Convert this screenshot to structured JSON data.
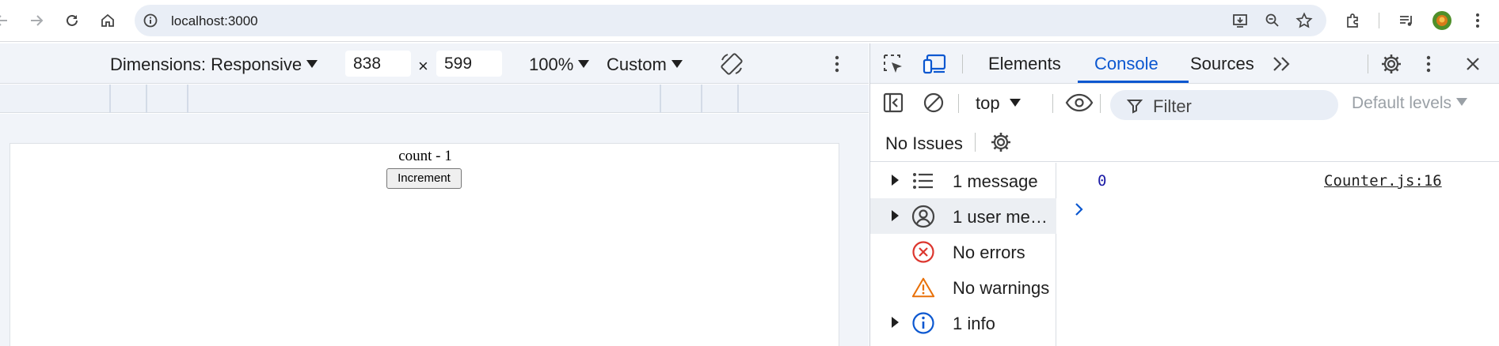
{
  "browser": {
    "url": "localhost:3000",
    "icons": [
      "back-icon",
      "forward-icon",
      "reload-icon",
      "home-icon",
      "site-info-icon",
      "install-app-icon",
      "zoom-icon",
      "bookmark-star-icon",
      "extensions-icon",
      "media-control-icon",
      "profile-avatar",
      "more-vert-icon"
    ]
  },
  "device_toolbar": {
    "dimensions_label": "Dimensions: Responsive",
    "width": "838",
    "times": "×",
    "height": "599",
    "zoom": "100%",
    "throttle": "Custom"
  },
  "page": {
    "counter_text": "count - 1",
    "increment_label": "Increment"
  },
  "devtools": {
    "tabs": [
      "Elements",
      "Console",
      "Sources"
    ],
    "active_tab": "Console",
    "more_tabs": "»",
    "context": "top",
    "filter_placeholder": "Filter",
    "levels": "Default levels",
    "issues": "No Issues",
    "sidebar": [
      {
        "label": "1 message",
        "icon": "list-icon",
        "expandable": true
      },
      {
        "label": "1 user mes…",
        "icon": "user-icon",
        "expandable": true
      },
      {
        "label": "No errors",
        "icon": "error-icon",
        "expandable": false
      },
      {
        "label": "No warnings",
        "icon": "warning-icon",
        "expandable": false
      },
      {
        "label": "1 info",
        "icon": "info-icon",
        "expandable": true
      }
    ],
    "log_value": "0",
    "log_source": "Counter.js:16"
  },
  "colors": {
    "accent": "#0b57d0",
    "error": "#dc362e",
    "warning": "#e8710a",
    "info": "#0b57d0"
  }
}
